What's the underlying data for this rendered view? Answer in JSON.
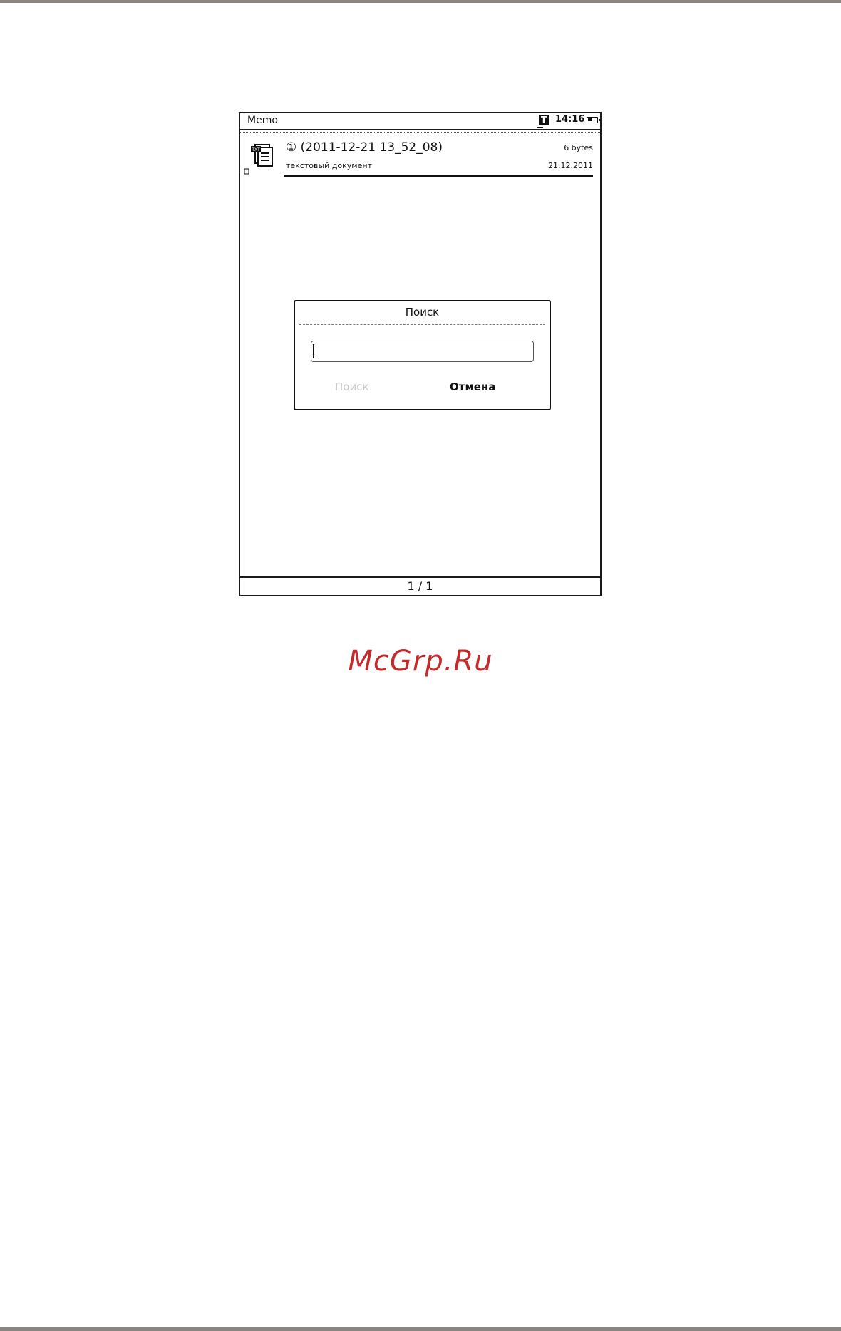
{
  "statusbar": {
    "app_title": "Memo",
    "t_icon_label": "T",
    "time": "14:16",
    "battery_icon": "battery-icon"
  },
  "file": {
    "icon": "txt-document-icon",
    "icon_label": "TXT",
    "title": "① (2011-12-21 13_52_08)",
    "size": "6 bytes",
    "type": "текстовый документ",
    "date": "21.12.2011"
  },
  "dialog": {
    "title": "Поиск",
    "input_value": "",
    "search_label": "Поиск",
    "cancel_label": "Отмена"
  },
  "pager": "1 / 1",
  "watermark": "McGrp.Ru",
  "colors": {
    "frame": "#1a1a1a",
    "disabled_text": "#c8c8c8",
    "watermark": "#c52a2a",
    "page_edge": "#8a8580"
  }
}
